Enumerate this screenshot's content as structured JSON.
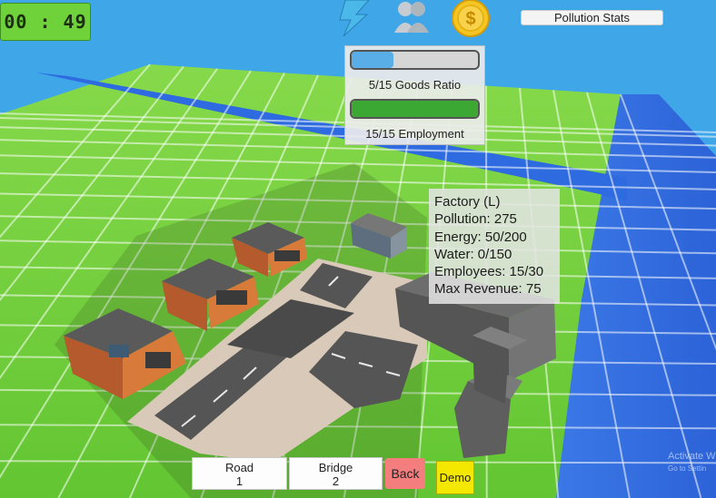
{
  "hud": {
    "timer": "00 : 49",
    "pollution_button": "Pollution Stats",
    "icons": [
      "lightning-icon",
      "people-icon",
      "coin-icon"
    ]
  },
  "stats": {
    "goods": {
      "label": "5/15 Goods Ratio",
      "fraction": 0.333,
      "color": "#5aaee8"
    },
    "employment": {
      "label": "15/15 Employment",
      "fraction": 1.0,
      "color": "#3aa832"
    }
  },
  "building_info": {
    "name": "Factory (L)",
    "pollution": "Pollution: 275",
    "energy": "Energy: 50/200",
    "water": "Water: 0/150",
    "employees": "Employees: 15/30",
    "revenue": "Max Revenue: 75"
  },
  "toolbar": {
    "road": {
      "name": "Road",
      "count": "1"
    },
    "bridge": {
      "name": "Bridge",
      "count": "2"
    },
    "back": "Back",
    "demo": "Demo"
  },
  "watermark": {
    "line1": "Activate W",
    "line2": "Go to Settin"
  },
  "colors": {
    "grass": "#6ccc3a",
    "water": "#2f6fe0",
    "sky": "#3fa6e8",
    "road": "#5b5b5b"
  }
}
